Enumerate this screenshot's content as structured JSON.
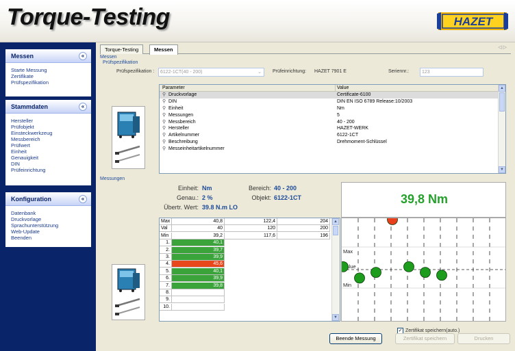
{
  "app": {
    "title": "Torque-Testing",
    "logo_text": "HAZET"
  },
  "sidebar": {
    "panels": [
      {
        "title": "Messen",
        "items": [
          "Starte Messung",
          "Zertifikate",
          "Prüfspezifikation"
        ]
      },
      {
        "title": "Stammdaten",
        "items": [
          "Hersteller",
          "Prüfobjekt",
          "Einsteckwerkzeug",
          "Messbereich",
          "Prüfwert",
          "Einheit",
          "Genauigkeit",
          "DIN",
          "Prüfeinrichtung"
        ]
      },
      {
        "title": "Konfiguration",
        "items": [
          "Datenbank",
          "Druckvorlage",
          "Sprachunterstützung",
          "Web-Update",
          "Beenden"
        ]
      }
    ]
  },
  "tabs": [
    {
      "label": "Torque-Testing",
      "active": false
    },
    {
      "label": "Messen",
      "active": true
    }
  ],
  "tab_nav": "◁ ▷",
  "section": {
    "messen": "Messen",
    "pruefspezifikation": "Prüfspezifikation",
    "messungen": "Messungen"
  },
  "form": {
    "spec_label": "Prüfspezifikation :",
    "spec_value": "6122-1CT(40 - 200)",
    "device_label": "Prüfeinrichtung:",
    "device_value": "HAZET 7901 E",
    "serial_label": "Seriennr.:",
    "serial_value": "123"
  },
  "param_table": {
    "columns": [
      "Parameter",
      "Value"
    ],
    "rows": [
      {
        "param": "Druckvorlage",
        "value": "Certificate-6100"
      },
      {
        "param": "DIN",
        "value": "DIN EN ISO 6789 Release:10/2003"
      },
      {
        "param": "Einheit",
        "value": "Nm"
      },
      {
        "param": "Messungen",
        "value": "5"
      },
      {
        "param": "Messbereich",
        "value": "40 - 200"
      },
      {
        "param": "Hersteller",
        "value": "HAZET-WERK"
      },
      {
        "param": "Artikelnummer",
        "value": "6122-1CT"
      },
      {
        "param": "Beschreibung",
        "value": "Drehmoment-Schlüssel"
      },
      {
        "param": "Messeinheitartikelnummer",
        "value": ""
      }
    ]
  },
  "summary": {
    "einheit_label": "Einheit:",
    "einheit_value": "Nm",
    "bereich_label": "Bereich:",
    "bereich_value": "40 - 200",
    "genau_label": "Genau.:",
    "genau_value": "2 %",
    "objekt_label": "Objekt:",
    "objekt_value": "6122-1CT",
    "uebertr_label": "Übertr. Wert:",
    "uebertr_value": "39.8 N.m LO",
    "big_value": "39,8 Nm",
    "big_value_color": "#24a02b"
  },
  "grid": {
    "stats": [
      {
        "label": "Max",
        "v1": "40,8",
        "v2": "122,4",
        "v3": "204"
      },
      {
        "label": "Val",
        "v1": "40",
        "v2": "120",
        "v3": "200"
      },
      {
        "label": "Min",
        "v1": "39,2",
        "v2": "117,6",
        "v3": "196"
      }
    ],
    "measurements": [
      {
        "n": "1.",
        "value": "40,1",
        "status": "ok"
      },
      {
        "n": "2.",
        "value": "39,7",
        "status": "ok"
      },
      {
        "n": "3.",
        "value": "39,9",
        "status": "ok"
      },
      {
        "n": "4.",
        "value": "45,6",
        "status": "bad"
      },
      {
        "n": "5.",
        "value": "40,1",
        "status": "ok"
      },
      {
        "n": "6.",
        "value": "39,9",
        "status": "ok"
      },
      {
        "n": "7.",
        "value": "39,8",
        "status": "ok"
      },
      {
        "n": "8.",
        "value": "",
        "status": "empty"
      },
      {
        "n": "9.",
        "value": "",
        "status": "empty"
      },
      {
        "n": "10.",
        "value": "",
        "status": "empty"
      }
    ]
  },
  "plot": {
    "labels": {
      "max": "Max",
      "value": "Value",
      "min": "Min"
    },
    "colors": {
      "ok": "#1e9c1e",
      "bad": "#e8401c"
    },
    "points": [
      {
        "index": 1,
        "value": 40.1,
        "status": "ok"
      },
      {
        "index": 2,
        "value": 39.7,
        "status": "ok"
      },
      {
        "index": 3,
        "value": 39.9,
        "status": "ok"
      },
      {
        "index": 4,
        "value": 45.6,
        "status": "bad"
      },
      {
        "index": 5,
        "value": 40.1,
        "status": "ok"
      },
      {
        "index": 6,
        "value": 39.9,
        "status": "ok"
      },
      {
        "index": 7,
        "value": 39.8,
        "status": "ok"
      }
    ]
  },
  "controls": {
    "auto_save_label": "Zertifikat speichern(auto.)",
    "auto_save_checked": true,
    "btn_stop": "Beende Messung",
    "btn_save": "Zertifikat speichern",
    "btn_print": "Drucken"
  }
}
